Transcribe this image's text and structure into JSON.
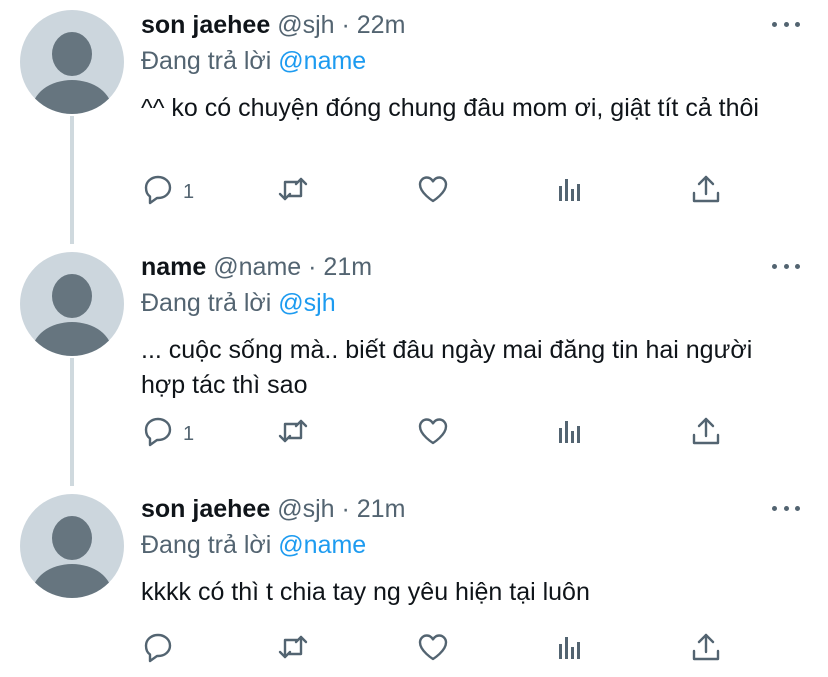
{
  "tweets": [
    {
      "name": "son jaehee",
      "handle": "@sjh",
      "time": "22m",
      "replying_prefix": "Đang trả lời",
      "replying_to": "@name",
      "text": "^^ ko có chuyện đóng chung đâu mom ơi, giật tít cả thôi",
      "reply_count": "1"
    },
    {
      "name": "name",
      "handle": "@name",
      "time": "21m",
      "replying_prefix": "Đang trả lời",
      "replying_to": "@sjh",
      "text": "... cuộc sống mà.. biết đâu ngày mai đăng tin hai người hợp tác thì sao",
      "reply_count": "1"
    },
    {
      "name": "son jaehee",
      "handle": "@sjh",
      "time": "21m",
      "replying_prefix": "Đang trả lời",
      "replying_to": "@name",
      "text": "kkkk có thì t chia tay ng yêu hiện tại luôn",
      "reply_count": ""
    }
  ],
  "separator": "·",
  "icons": {
    "reply": "reply-icon",
    "retweet": "retweet-icon",
    "like": "heart-icon",
    "analytics": "analytics-icon",
    "share": "share-icon",
    "more": "more-icon"
  },
  "colors": {
    "mention": "#1d9bf0",
    "secondary_text": "#536471",
    "thread_line": "#cfd9de",
    "avatar_bg": "#ccd6dd"
  }
}
